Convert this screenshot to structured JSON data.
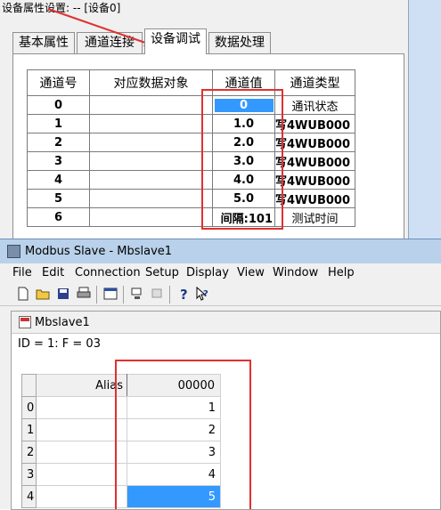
{
  "dialog": {
    "title": "设备属性设置: -- [设备0]",
    "tabs": [
      "基本属性",
      "通道连接",
      "设备调试",
      "数据处理"
    ],
    "active_tab": 2,
    "columns": [
      "通道号",
      "对应数据对象",
      "通道值",
      "通道类型"
    ],
    "rows": [
      {
        "ch": "0",
        "obj": "",
        "val": "0",
        "type": "通讯状态",
        "selected": true
      },
      {
        "ch": "1",
        "obj": "",
        "val": "1.0",
        "type": "写4WUB000"
      },
      {
        "ch": "2",
        "obj": "",
        "val": "2.0",
        "type": "写4WUB000"
      },
      {
        "ch": "3",
        "obj": "",
        "val": "3.0",
        "type": "写4WUB000"
      },
      {
        "ch": "4",
        "obj": "",
        "val": "4.0",
        "type": "写4WUB000"
      },
      {
        "ch": "5",
        "obj": "",
        "val": "5.0",
        "type": "写4WUB000"
      },
      {
        "ch": "6",
        "obj": "",
        "val": "间隔:101",
        "type": "测试时间"
      }
    ]
  },
  "modbus": {
    "title": "Modbus Slave - Mbslave1",
    "menu": [
      "File",
      "Edit",
      "Connection",
      "Setup",
      "Display",
      "View",
      "Window",
      "Help"
    ],
    "toolbar_icons": [
      "new-icon",
      "open-icon",
      "save-icon",
      "print-icon",
      "window-icon",
      "connect-icon",
      "disconnect-icon",
      "help-icon",
      "context-help-icon"
    ],
    "child_title": "Mbslave1",
    "id_line": "ID = 1: F = 03",
    "grid": {
      "alias_header": "Alias",
      "value_header": "00000",
      "rows": [
        {
          "idx": "0",
          "alias": "",
          "value": "1"
        },
        {
          "idx": "1",
          "alias": "",
          "value": "2"
        },
        {
          "idx": "2",
          "alias": "",
          "value": "3"
        },
        {
          "idx": "3",
          "alias": "",
          "value": "4"
        },
        {
          "idx": "4",
          "alias": "",
          "value": "5",
          "selected": true
        }
      ]
    }
  },
  "colors": {
    "highlight": "#e03030",
    "selection": "#3399ff"
  }
}
